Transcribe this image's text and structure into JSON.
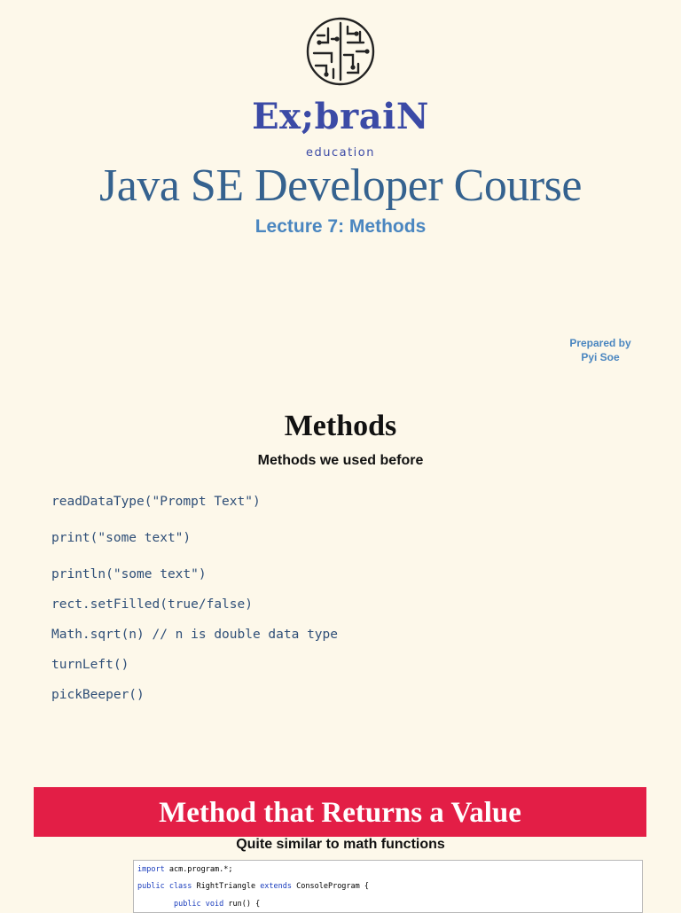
{
  "brand": {
    "name": "Ex;braiN",
    "tagline": "education",
    "logo_icon": "circuit-brain-icon",
    "color": "#3b4aa6"
  },
  "cover": {
    "title": "Java SE Developer Course",
    "lecture": "Lecture 7: Methods",
    "prepared_label": "Prepared by",
    "author": "Pyi Soe"
  },
  "methods_section": {
    "title": "Methods",
    "subtitle": "Methods we used before",
    "items": [
      "readDataType(\"Prompt Text\")",
      "print(\"some text\")",
      "println(\"some text\")",
      "rect.setFilled(true/false)",
      "Math.sqrt(n) // n is double data type",
      "turnLeft()",
      "pickBeeper()"
    ]
  },
  "returns_section": {
    "title": "Method that Returns a Value",
    "subtitle": "Quite similar to math functions",
    "banner_color": "#e31e46",
    "code": {
      "line1": {
        "kw": "import",
        "rest": " acm.program.*;"
      },
      "line2": {
        "kw1": "public class",
        "mid": " RightTriangle ",
        "kw2": "extends",
        "rest": " ConsoleProgram {"
      },
      "line3": {
        "indent": "        ",
        "kw": "public void",
        "rest": " run() {"
      }
    }
  }
}
